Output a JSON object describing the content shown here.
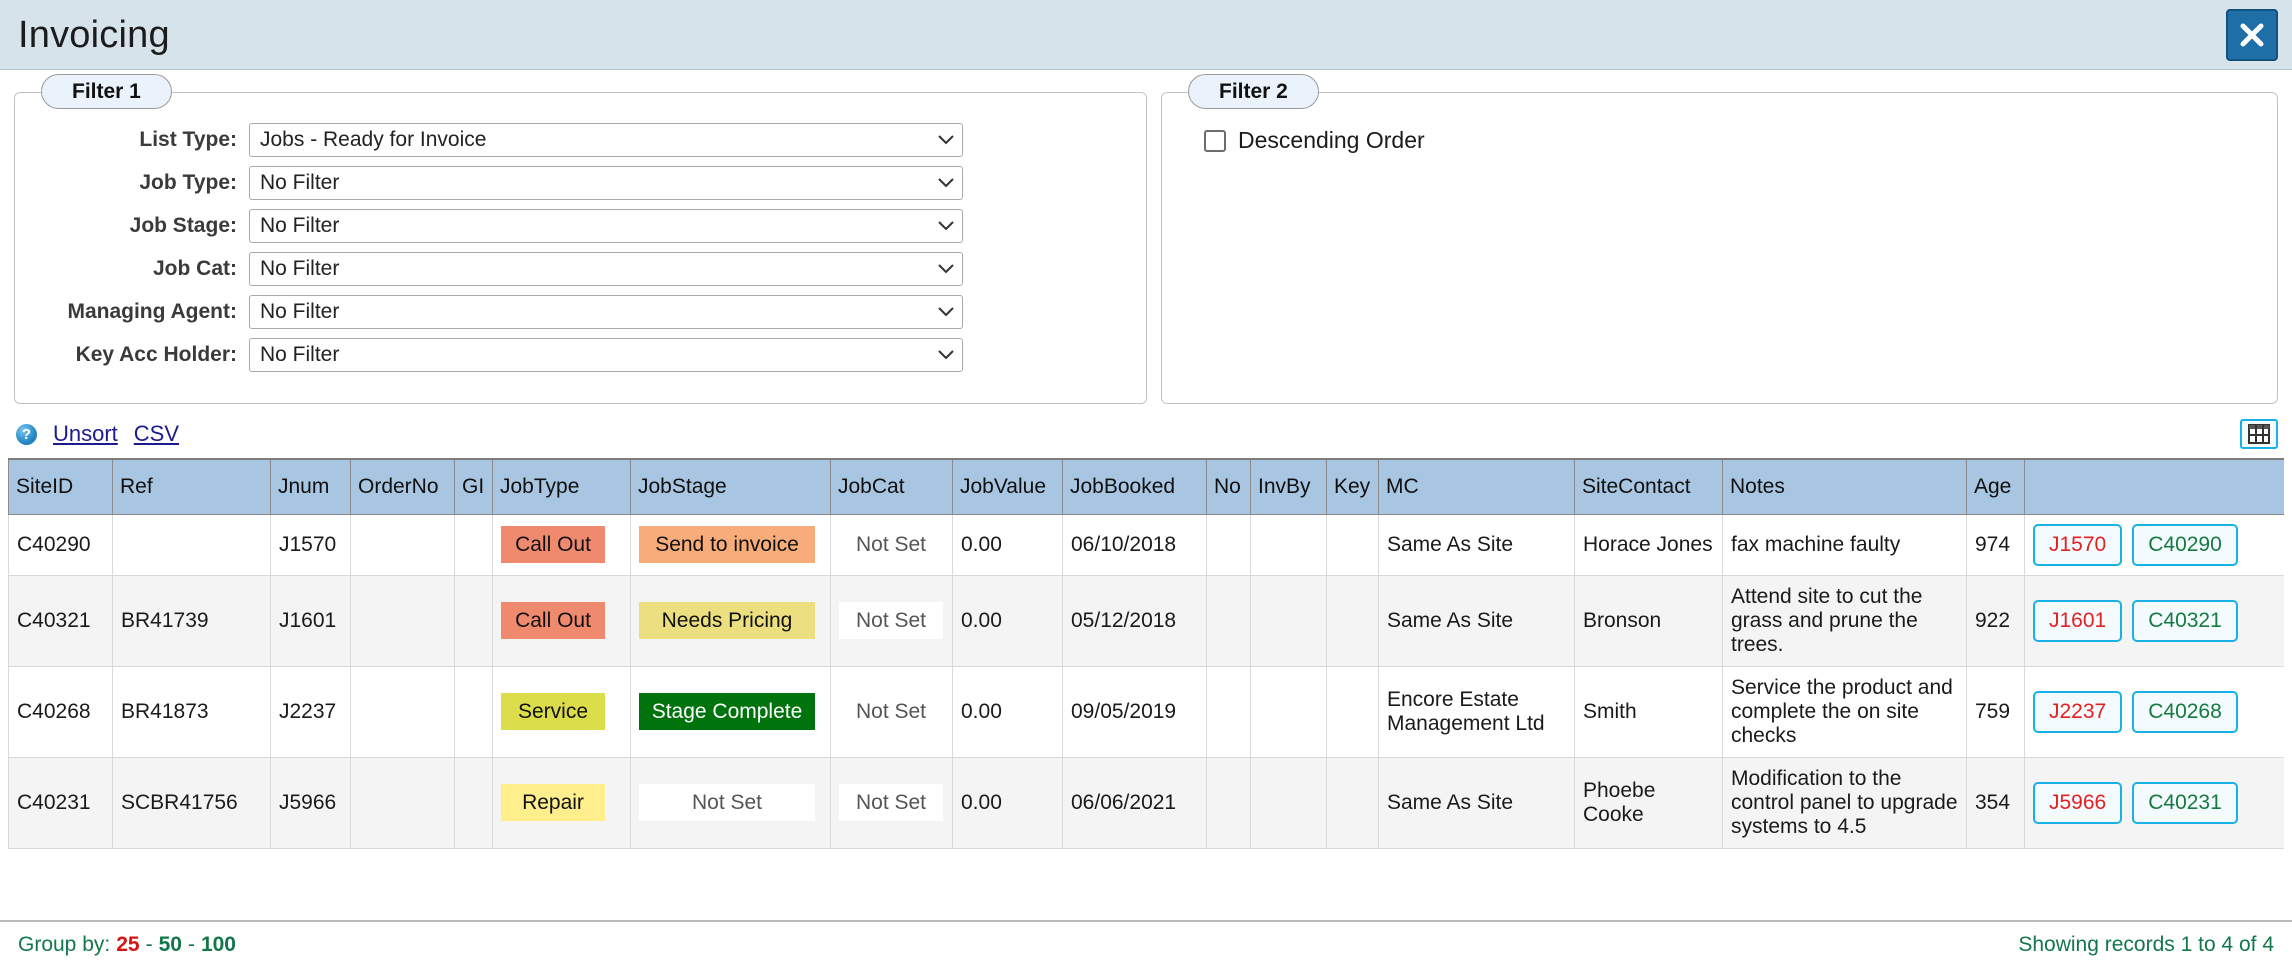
{
  "window": {
    "title": "Invoicing",
    "close_label": "✕"
  },
  "filter1": {
    "legend": "Filter 1",
    "rows": [
      {
        "label": "List Type:",
        "value": "Jobs - Ready for Invoice"
      },
      {
        "label": "Job Type:",
        "value": "No Filter"
      },
      {
        "label": "Job Stage:",
        "value": "No Filter"
      },
      {
        "label": "Job Cat:",
        "value": "No Filter"
      },
      {
        "label": "Managing Agent:",
        "value": "No Filter"
      },
      {
        "label": "Key Acc Holder:",
        "value": "No Filter"
      }
    ]
  },
  "filter2": {
    "legend": "Filter 2",
    "descending_label": "Descending Order",
    "descending_checked": false
  },
  "toolbar": {
    "help_glyph": "?",
    "unsort_label": "Unsort",
    "csv_label": "CSV",
    "grid_icon": "table-grid-icon"
  },
  "table": {
    "columns": [
      "SiteID",
      "Ref",
      "Jnum",
      "OrderNo",
      "GI",
      "JobType",
      "JobStage",
      "JobCat",
      "JobValue",
      "JobBooked",
      "No",
      "InvBy",
      "Key",
      "MC",
      "SiteContact",
      "Notes",
      "Age",
      ""
    ],
    "rows": [
      {
        "siteid": "C40290",
        "ref": "",
        "jnum": "J1570",
        "orderno": "",
        "gi": "",
        "jobtype": "Call Out",
        "jobtype_color": "#f08a6f",
        "jobstage": "Send to invoice",
        "jobstage_color": "#f7ac79",
        "jobstage_text": "#111111",
        "jobcat": "Not Set",
        "jobvalue": "0.00",
        "jobbooked": "06/10/2018",
        "no": "",
        "invby": "",
        "key": "",
        "mc": "Same As Site",
        "sitecontact": "Horace Jones",
        "notes": "fax machine faulty",
        "age": "974",
        "action_jnum": "J1570",
        "action_site": "C40290"
      },
      {
        "siteid": "C40321",
        "ref": "BR41739",
        "jnum": "J1601",
        "orderno": "",
        "gi": "",
        "jobtype": "Call Out",
        "jobtype_color": "#f08a6f",
        "jobstage": "Needs Pricing",
        "jobstage_color": "#ebdf7f",
        "jobstage_text": "#111111",
        "jobcat": "Not Set",
        "jobvalue": "0.00",
        "jobbooked": "05/12/2018",
        "no": "",
        "invby": "",
        "key": "",
        "mc": "Same As Site",
        "sitecontact": "Bronson",
        "notes": "Attend site to cut the grass and prune the trees.",
        "age": "922",
        "action_jnum": "J1601",
        "action_site": "C40321"
      },
      {
        "siteid": "C40268",
        "ref": "BR41873",
        "jnum": "J2237",
        "orderno": "",
        "gi": "",
        "jobtype": "Service",
        "jobtype_color": "#dcdd4b",
        "jobstage": "Stage Complete",
        "jobstage_color": "#00730d",
        "jobstage_text": "#ffffff",
        "jobcat": "Not Set",
        "jobvalue": "0.00",
        "jobbooked": "09/05/2019",
        "no": "",
        "invby": "",
        "key": "",
        "mc": "Encore Estate Management Ltd",
        "sitecontact": "Smith",
        "notes": "Service the product and complete the on site checks",
        "age": "759",
        "action_jnum": "J2237",
        "action_site": "C40268"
      },
      {
        "siteid": "C40231",
        "ref": "SCBR41756",
        "jnum": "J5966",
        "orderno": "",
        "gi": "",
        "jobtype": "Repair",
        "jobtype_color": "#ffee8c",
        "jobstage": "Not Set",
        "jobstage_color": "#ffffff",
        "jobstage_text": "#555555",
        "jobcat": "Not Set",
        "jobvalue": "0.00",
        "jobbooked": "06/06/2021",
        "no": "",
        "invby": "",
        "key": "",
        "mc": "Same As Site",
        "sitecontact": "Phoebe Cooke",
        "notes": "Modification to the control panel to upgrade systems to 4.5",
        "age": "354",
        "action_jnum": "J5966",
        "action_site": "C40231"
      }
    ]
  },
  "footer": {
    "groupby_label": "Group by:",
    "groupby_options": [
      "25",
      "50",
      "100"
    ],
    "groupby_active": "25",
    "records_text": "Showing records 1 to 4 of 4"
  },
  "colors": {
    "titlebar_bg": "#d6e3ea",
    "header_bg": "#a8c6e2",
    "accent_cyan": "#18b2e8",
    "link_green": "#12774a",
    "active_red": "#d81515"
  }
}
